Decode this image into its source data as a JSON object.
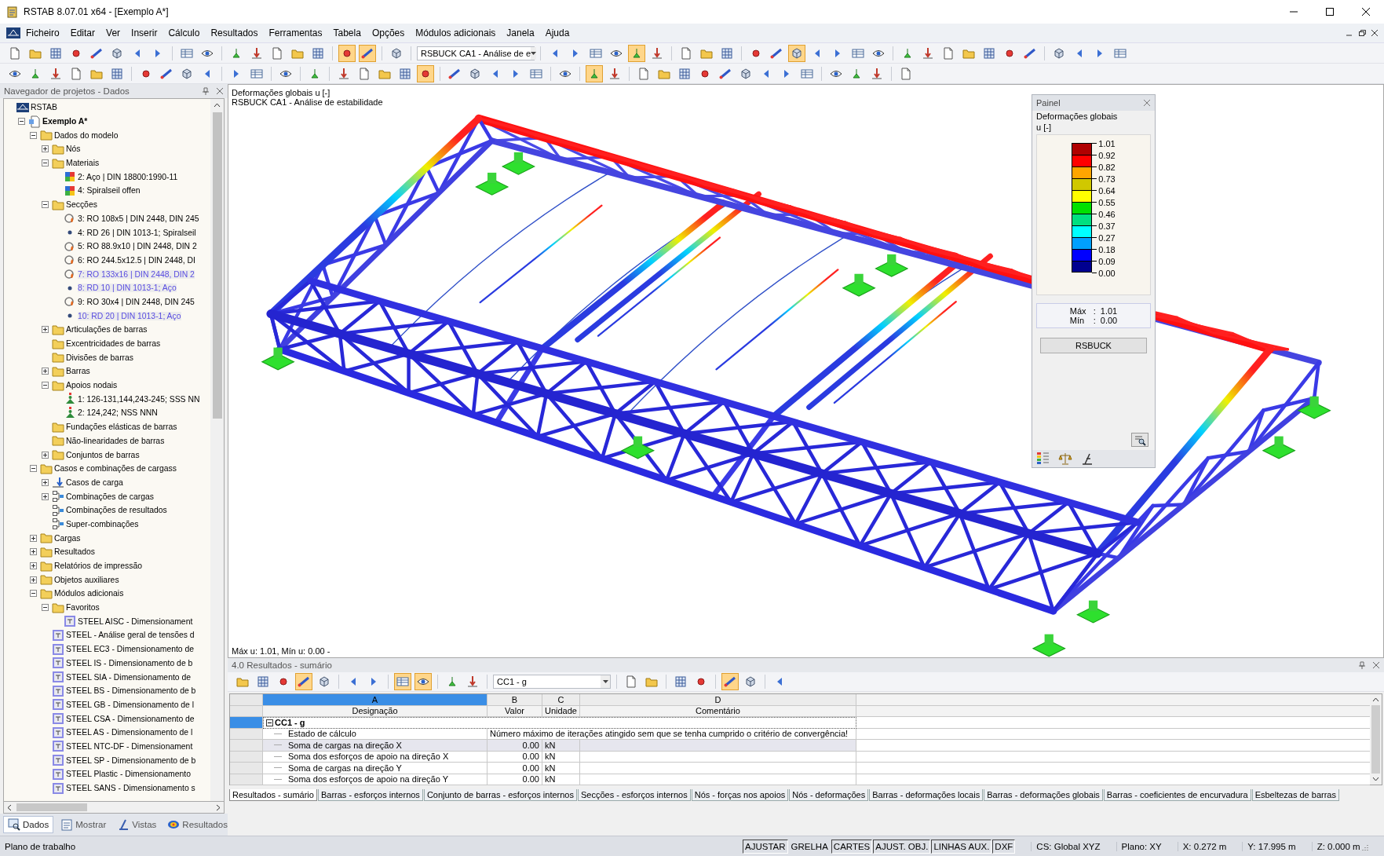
{
  "window": {
    "title": "RSTAB 8.07.01 x64 - [Exemplo A*]"
  },
  "menu": [
    "Ficheiro",
    "Editar",
    "Ver",
    "Inserir",
    "Cálculo",
    "Resultados",
    "Ferramentas",
    "Tabela",
    "Opções",
    "Módulos adicionais",
    "Janela",
    "Ajuda"
  ],
  "toolbar_1": [
    {
      "kind": "buttons",
      "buttons": [
        {
          "on": false
        },
        {
          "on": false
        },
        {
          "on": false
        },
        {
          "on": false
        },
        {
          "on": false
        },
        {
          "on": false
        },
        {
          "on": false
        },
        {
          "on": false
        }
      ]
    },
    {
      "kind": "buttons",
      "buttons": [
        {
          "on": false
        },
        {
          "on": false
        }
      ]
    },
    {
      "kind": "buttons",
      "buttons": [
        {
          "on": false
        },
        {
          "on": false
        },
        {
          "on": false
        },
        {
          "on": false
        },
        {
          "on": false
        }
      ]
    },
    {
      "kind": "buttons",
      "buttons": [
        {
          "on": true
        },
        {
          "on": true
        }
      ]
    },
    {
      "kind": "buttons",
      "buttons": [
        {
          "on": false
        }
      ]
    },
    {
      "kind": "combo",
      "value": "RSBUCK CA1 - Análise de e"
    },
    {
      "kind": "buttons",
      "buttons": [
        {
          "on": false
        },
        {
          "on": false
        },
        {
          "on": false
        },
        {
          "on": false
        },
        {
          "on": true
        },
        {
          "on": false
        }
      ]
    },
    {
      "kind": "buttons",
      "buttons": [
        {
          "on": false
        },
        {
          "on": false
        },
        {
          "on": false
        }
      ]
    },
    {
      "kind": "buttons",
      "buttons": [
        {
          "on": false
        },
        {
          "on": false
        },
        {
          "on": true
        },
        {
          "on": false
        },
        {
          "on": false
        },
        {
          "on": false
        },
        {
          "on": false
        }
      ]
    },
    {
      "kind": "buttons",
      "buttons": [
        {
          "on": false
        },
        {
          "on": false
        },
        {
          "on": false
        },
        {
          "on": false
        },
        {
          "on": false
        },
        {
          "on": false
        },
        {
          "on": false
        }
      ]
    },
    {
      "kind": "buttons",
      "buttons": [
        {
          "on": false
        },
        {
          "on": false
        },
        {
          "on": false
        },
        {
          "on": false
        }
      ]
    }
  ],
  "toolbar_2": [
    {
      "kind": "buttons",
      "buttons": [
        {
          "on": false
        },
        {
          "on": false
        },
        {
          "on": false
        },
        {
          "on": false
        },
        {
          "on": false
        },
        {
          "on": false
        }
      ]
    },
    {
      "kind": "buttons",
      "buttons": [
        {
          "on": false
        },
        {
          "on": false
        },
        {
          "on": false
        },
        {
          "on": false
        }
      ]
    },
    {
      "kind": "buttons",
      "buttons": [
        {
          "on": false
        },
        {
          "on": false
        }
      ]
    },
    {
      "kind": "buttons",
      "buttons": [
        {
          "on": false
        }
      ]
    },
    {
      "kind": "buttons",
      "buttons": [
        {
          "on": false
        }
      ]
    },
    {
      "kind": "buttons",
      "buttons": [
        {
          "on": false
        },
        {
          "on": false
        },
        {
          "on": false
        },
        {
          "on": false
        },
        {
          "on": true
        }
      ]
    },
    {
      "kind": "buttons",
      "buttons": [
        {
          "on": false
        },
        {
          "on": false
        },
        {
          "on": false
        },
        {
          "on": false
        },
        {
          "on": false
        }
      ]
    },
    {
      "kind": "buttons",
      "buttons": [
        {
          "on": false
        }
      ]
    },
    {
      "kind": "buttons",
      "buttons": [
        {
          "on": true
        },
        {
          "on": false
        }
      ]
    },
    {
      "kind": "buttons",
      "buttons": [
        {
          "on": false
        },
        {
          "on": false
        },
        {
          "on": false
        },
        {
          "on": false
        },
        {
          "on": false
        },
        {
          "on": false
        },
        {
          "on": false
        },
        {
          "on": false
        },
        {
          "on": false
        }
      ]
    },
    {
      "kind": "buttons",
      "buttons": [
        {
          "on": false
        },
        {
          "on": false
        },
        {
          "on": false
        }
      ]
    },
    {
      "kind": "buttons",
      "buttons": [
        {
          "on": false
        }
      ]
    }
  ],
  "navigator": {
    "title": "Navegador de projetos - Dados",
    "tree": [
      {
        "label": "RSTAB",
        "kind": "root",
        "children": [
          {
            "label": "Exemplo A*",
            "kind": "project",
            "expanded": true,
            "children": [
              {
                "label": "Dados do modelo",
                "kind": "folder",
                "expanded": true,
                "children": [
                  {
                    "label": "Nós",
                    "kind": "folder",
                    "expanded": false
                  },
                  {
                    "label": "Materiais",
                    "kind": "folder",
                    "expanded": true,
                    "children": [
                      {
                        "label": "2: Aço | DIN 18800:1990-11",
                        "kind": "material"
                      },
                      {
                        "label": "4: Spiralseil offen",
                        "kind": "material"
                      }
                    ]
                  },
                  {
                    "label": "Secções",
                    "kind": "folder",
                    "expanded": true,
                    "children": [
                      {
                        "label": "3: RO 108x5 | DIN 2448, DIN 245",
                        "kind": "tube",
                        "highlighted": false
                      },
                      {
                        "label": "4: RD 26 | DIN 1013-1; Spiralseil",
                        "kind": "rod",
                        "highlighted": false
                      },
                      {
                        "label": "5: RO 88.9x10 | DIN 2448, DIN 2",
                        "kind": "tube",
                        "highlighted": false
                      },
                      {
                        "label": "6: RO 244.5x12.5 | DIN 2448, DI",
                        "kind": "tube",
                        "highlighted": false
                      },
                      {
                        "label": "7: RO 133x16 | DIN 2448, DIN 2",
                        "kind": "tube",
                        "highlighted": true
                      },
                      {
                        "label": "8: RD 10 | DIN 1013-1; Aço",
                        "kind": "rod",
                        "highlighted": true
                      },
                      {
                        "label": "9: RO 30x4 | DIN 2448, DIN 245",
                        "kind": "tube",
                        "highlighted": false
                      },
                      {
                        "label": "10: RD 20 | DIN 1013-1; Aço",
                        "kind": "rod",
                        "highlighted": true
                      }
                    ]
                  },
                  {
                    "label": "Articulações de barras",
                    "kind": "folder",
                    "expanded": false
                  },
                  {
                    "label": "Excentricidades de barras",
                    "kind": "folder"
                  },
                  {
                    "label": "Divisões de barras",
                    "kind": "folder"
                  },
                  {
                    "label": "Barras",
                    "kind": "folder",
                    "expanded": false
                  },
                  {
                    "label": "Apoios nodais",
                    "kind": "folder",
                    "expanded": true,
                    "children": [
                      {
                        "label": "1: 126-131,144,243-245; SSS NN",
                        "kind": "support"
                      },
                      {
                        "label": "2: 124,242; NSS NNN",
                        "kind": "support"
                      }
                    ]
                  },
                  {
                    "label": "Fundações elásticas de barras",
                    "kind": "folder"
                  },
                  {
                    "label": "Não-linearidades de barras",
                    "kind": "folder"
                  },
                  {
                    "label": "Conjuntos de barras",
                    "kind": "folder",
                    "expanded": false
                  }
                ]
              },
              {
                "label": "Casos e combinações de cargass",
                "kind": "folder",
                "expanded": true,
                "children": [
                  {
                    "label": "Casos de carga",
                    "kind": "loadcase",
                    "expanded": false
                  },
                  {
                    "label": "Combinações de cargas",
                    "kind": "combo",
                    "expanded": false
                  },
                  {
                    "label": "Combinações de resultados",
                    "kind": "combo"
                  },
                  {
                    "label": "Super-combinações",
                    "kind": "combo"
                  }
                ]
              },
              {
                "label": "Cargas",
                "kind": "folder",
                "expanded": false
              },
              {
                "label": "Resultados",
                "kind": "folder",
                "expanded": false
              },
              {
                "label": "Relatórios de impressão",
                "kind": "folder",
                "expanded": false
              },
              {
                "label": "Objetos auxiliares",
                "kind": "folder",
                "expanded": false
              },
              {
                "label": "Módulos adicionais",
                "kind": "folder",
                "expanded": true,
                "children": [
                  {
                    "label": "Favoritos",
                    "kind": "folder",
                    "expanded": true,
                    "children": [
                      {
                        "label": "STEEL AISC - Dimensionament",
                        "kind": "module"
                      }
                    ]
                  },
                  {
                    "label": "STEEL - Análise geral de tensões d",
                    "kind": "module"
                  },
                  {
                    "label": "STEEL EC3 - Dimensionamento de",
                    "kind": "module"
                  },
                  {
                    "label": "STEEL IS - Dimensionamento de b",
                    "kind": "module"
                  },
                  {
                    "label": "STEEL SIA - Dimensionamento de",
                    "kind": "module"
                  },
                  {
                    "label": "STEEL BS - Dimensionamento de b",
                    "kind": "module"
                  },
                  {
                    "label": "STEEL GB - Dimensionamento de l",
                    "kind": "module"
                  },
                  {
                    "label": "STEEL CSA - Dimensionamento de",
                    "kind": "module"
                  },
                  {
                    "label": "STEEL AS - Dimensionamento de l",
                    "kind": "module"
                  },
                  {
                    "label": "STEEL NTC-DF - Dimensionament",
                    "kind": "module"
                  },
                  {
                    "label": "STEEL SP - Dimensionamento de b",
                    "kind": "module"
                  },
                  {
                    "label": "STEEL Plastic - Dimensionamento",
                    "kind": "module"
                  },
                  {
                    "label": "STEEL SANS - Dimensionamento s",
                    "kind": "module"
                  }
                ]
              }
            ]
          }
        ]
      }
    ],
    "tabs": [
      {
        "label": "Dados",
        "selected": true
      },
      {
        "label": "Mostrar",
        "selected": false
      },
      {
        "label": "Vistas",
        "selected": false
      },
      {
        "label": "Resultados",
        "selected": false
      }
    ]
  },
  "viewport": {
    "title": "Deformações globais u [-]",
    "subtitle": "RSBUCK CA1 - Análise de estabilidade",
    "footer": "Máx u: 1.01, Mín u: 0.00 -"
  },
  "panel": {
    "title": "Painel",
    "heading": "Deformações globais",
    "unit": "u [-]",
    "bands": [
      {
        "color": "#b00000"
      },
      {
        "color": "#ff0000"
      },
      {
        "color": "#ffa500"
      },
      {
        "color": "#d0c800"
      },
      {
        "color": "#ffff00"
      },
      {
        "color": "#00e000"
      },
      {
        "color": "#00e080"
      },
      {
        "color": "#00ffff"
      },
      {
        "color": "#00a0ff"
      },
      {
        "color": "#0000ff"
      },
      {
        "color": "#000090"
      }
    ],
    "scale_labels": [
      "1.01",
      "0.92",
      "0.82",
      "0.73",
      "0.64",
      "0.55",
      "0.46",
      "0.37",
      "0.27",
      "0.18",
      "0.09",
      "0.00"
    ],
    "max_label": "Máx",
    "max_value": "1.01",
    "min_label": "Mín",
    "min_value": "0.00",
    "separator": ":",
    "button": "RSBUCK"
  },
  "results": {
    "title": "4.0 Resultados - sumário",
    "toolbar": [
      {
        "kind": "buttons",
        "buttons": [
          {
            "on": false
          },
          {
            "on": false
          },
          {
            "on": false
          },
          {
            "on": true
          },
          {
            "on": false
          }
        ]
      },
      {
        "kind": "buttons",
        "buttons": [
          {
            "on": false
          },
          {
            "on": false
          }
        ]
      },
      {
        "kind": "buttons",
        "buttons": [
          {
            "on": true
          },
          {
            "on": true
          }
        ]
      },
      {
        "kind": "buttons",
        "buttons": [
          {
            "on": false
          },
          {
            "on": false
          }
        ]
      },
      {
        "kind": "combo",
        "value": "CC1 - g"
      },
      {
        "kind": "buttons",
        "buttons": [
          {
            "on": false
          },
          {
            "on": false
          }
        ]
      },
      {
        "kind": "buttons",
        "buttons": [
          {
            "on": false
          },
          {
            "on": false
          }
        ]
      },
      {
        "kind": "buttons",
        "buttons": [
          {
            "on": true
          },
          {
            "on": false
          }
        ]
      },
      {
        "kind": "buttons",
        "buttons": [
          {
            "on": false
          }
        ]
      }
    ],
    "columns": [
      {
        "letter": "A",
        "title": "Designação"
      },
      {
        "letter": "B",
        "title": "Valor"
      },
      {
        "letter": "C",
        "title": "Unidade"
      },
      {
        "letter": "D",
        "title": "Comentário"
      }
    ],
    "group": {
      "title": "CC1 - g",
      "expanded": true,
      "selected": true
    },
    "rows": [
      {
        "kind": "message",
        "designation": "Estado de cálculo",
        "text": "Número máximo de iterações atingido sem que se tenha cumprido o critério de convergência!",
        "current": false
      },
      {
        "kind": "value",
        "designation": "Soma de cargas na direção X",
        "value": "0.00",
        "unit": "kN",
        "current": true
      },
      {
        "kind": "value",
        "designation": "Soma dos esforços de apoio na direção X",
        "value": "0.00",
        "unit": "kN",
        "current": false
      },
      {
        "kind": "value",
        "designation": "Soma de cargas na direção Y",
        "value": "0.00",
        "unit": "kN",
        "current": false
      },
      {
        "kind": "value",
        "designation": "Soma dos esforços de apoio na direção Y",
        "value": "0.00",
        "unit": "kN",
        "current": false
      }
    ],
    "tabs": [
      {
        "label": "Resultados - sumário",
        "selected": true
      },
      {
        "label": "Barras - esforços internos",
        "selected": false
      },
      {
        "label": "Conjunto de barras - esforços internos",
        "selected": false
      },
      {
        "label": "Secções - esforços internos",
        "selected": false
      },
      {
        "label": "Nós - forças nos apoios",
        "selected": false
      },
      {
        "label": "Nós - deformações",
        "selected": false
      },
      {
        "label": "Barras - deformações locais",
        "selected": false
      },
      {
        "label": "Barras - deformações globais",
        "selected": false
      },
      {
        "label": "Barras - coeficientes de encurvadura",
        "selected": false
      },
      {
        "label": "Esbeltezas de barras",
        "selected": false
      }
    ]
  },
  "status_bar": {
    "text": "Plano de trabalho",
    "toggles": [
      {
        "label": "AJUSTAR",
        "on": true
      },
      {
        "label": "GRELHA",
        "on": false
      },
      {
        "label": "CARTES",
        "on": true
      },
      {
        "label": "AJUST. OBJ.",
        "on": true
      },
      {
        "label": "LINHAS AUX.",
        "on": true
      },
      {
        "label": "DXF",
        "on": true
      }
    ],
    "fields": [
      "CS: Global XYZ",
      "Plano: XY",
      "X:  0.272 m",
      "Y:  17.995 m",
      "Z:  0.000 m"
    ]
  }
}
